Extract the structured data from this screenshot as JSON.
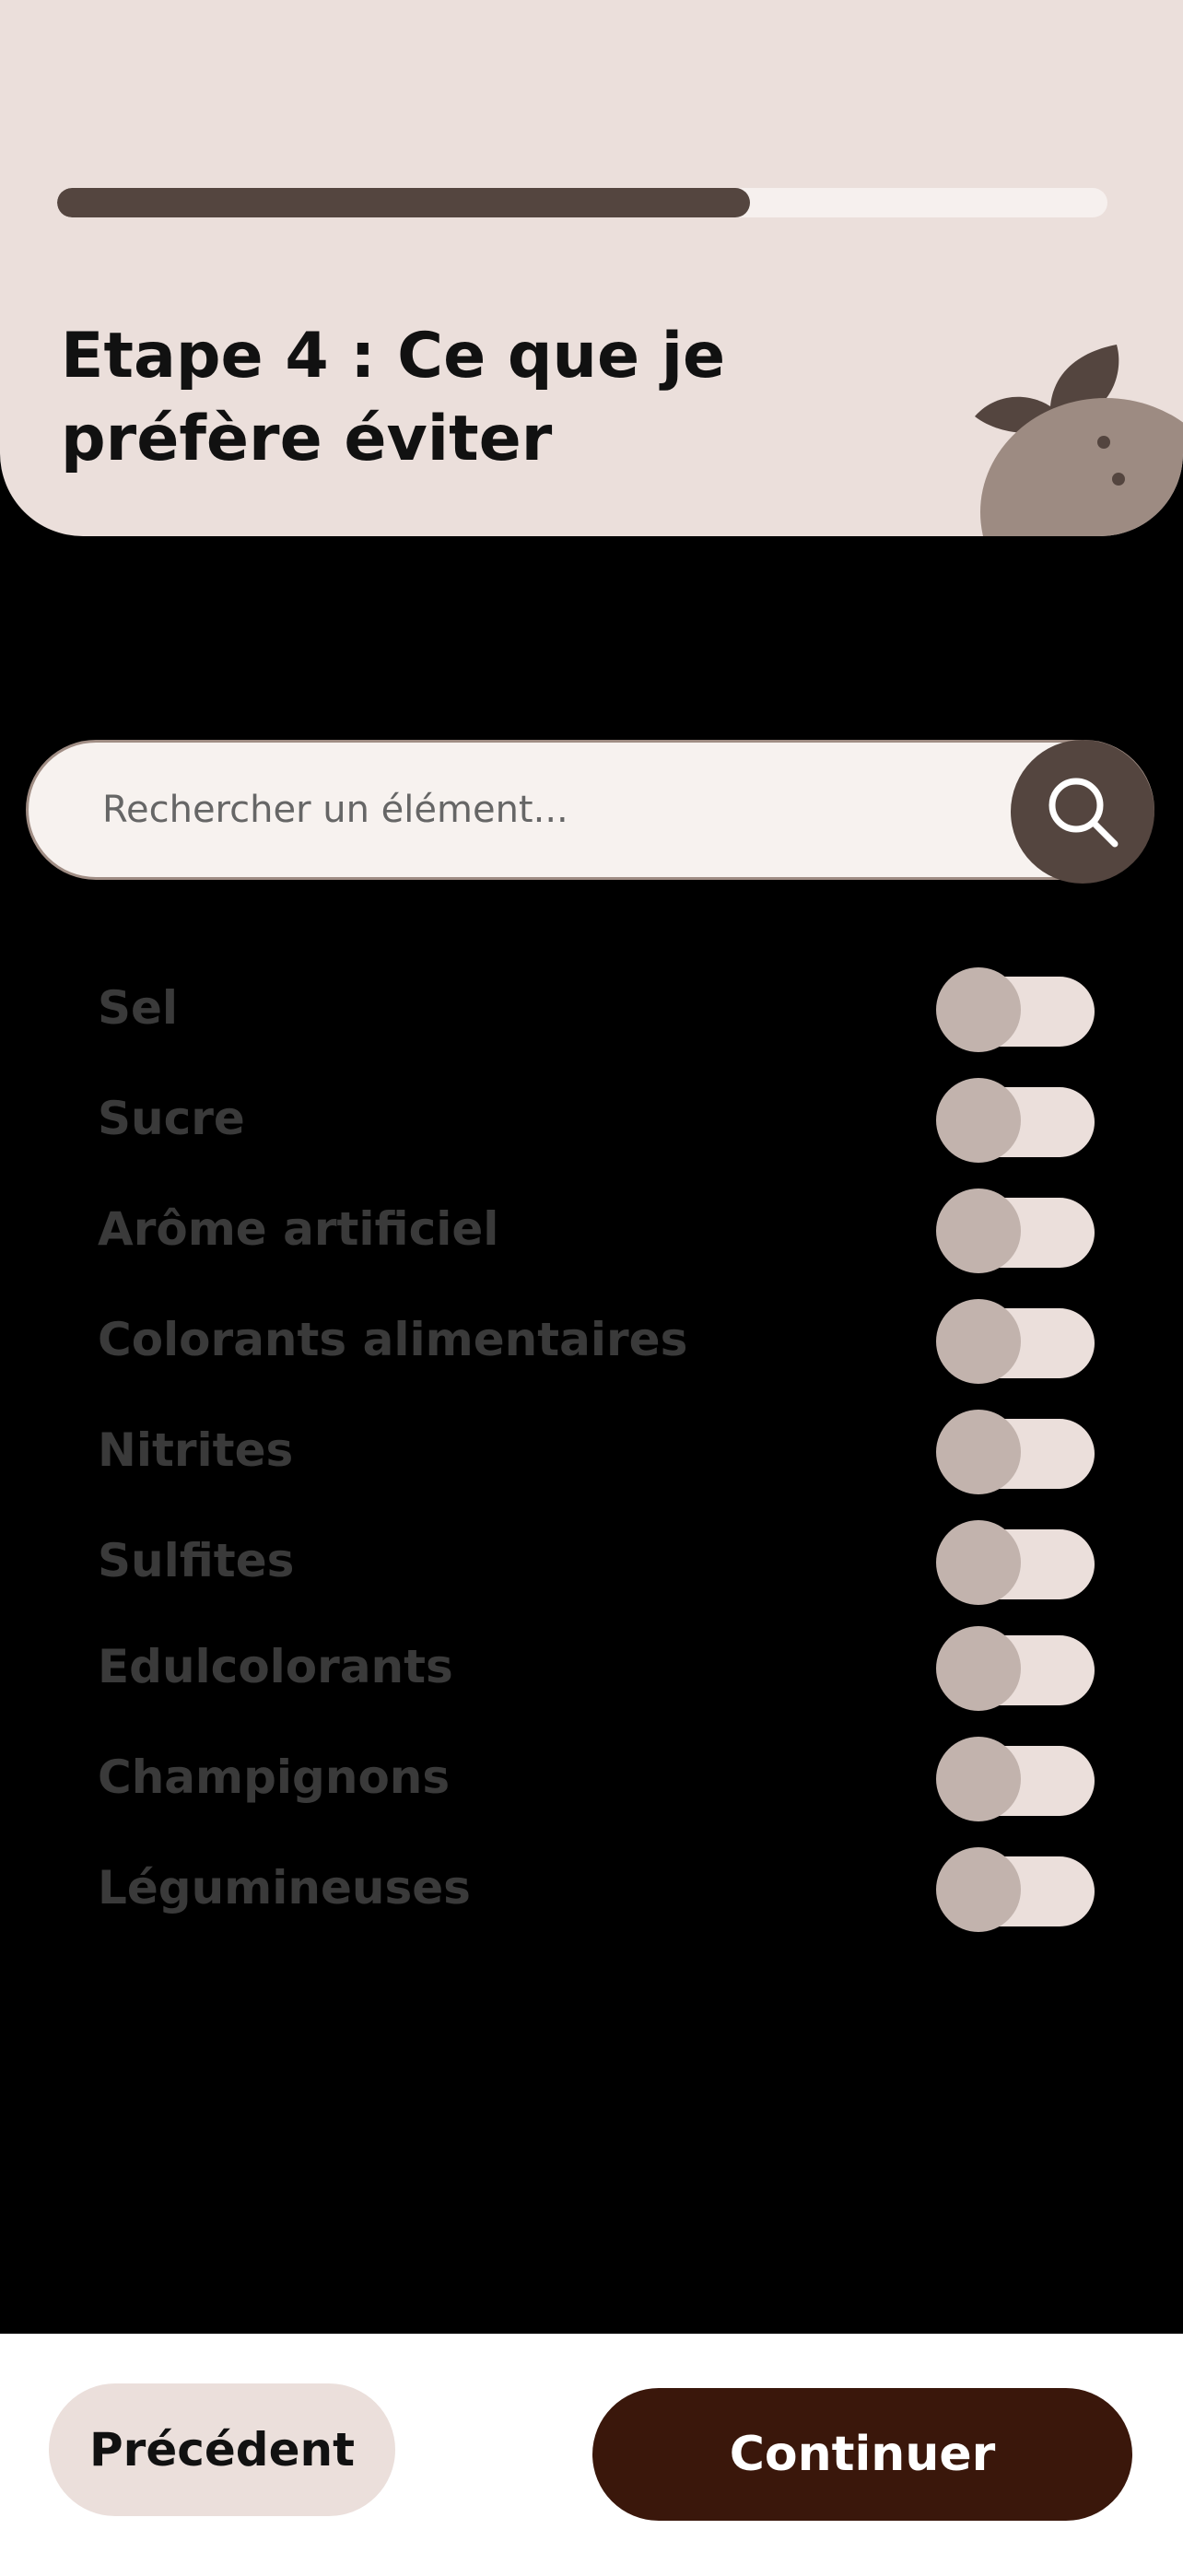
{
  "header": {
    "step_title": "Etape 4 : Ce que je préfère éviter",
    "progress": 0.66
  },
  "search": {
    "placeholder": "Rechercher un élément..."
  },
  "items": [
    {
      "label": "Sel",
      "enabled": false
    },
    {
      "label": "Sucre",
      "enabled": false
    },
    {
      "label": "Arôme artificiel",
      "enabled": false
    },
    {
      "label": "Colorants alimentaires",
      "enabled": false
    },
    {
      "label": "Nitrites",
      "enabled": false
    },
    {
      "label": "Sulfites",
      "enabled": false
    },
    {
      "label": "Edulcolorants",
      "enabled": false
    },
    {
      "label": "Champignons",
      "enabled": false
    },
    {
      "label": "Légumineuses",
      "enabled": false
    }
  ],
  "footer": {
    "previous_label": "Précédent",
    "continue_label": "Continuer"
  },
  "colors": {
    "header_bg": "#ebdfdb",
    "progress_fill": "#54453f",
    "primary_button": "#3a170b",
    "toggle_off_thumb": "#c2b3ad"
  }
}
